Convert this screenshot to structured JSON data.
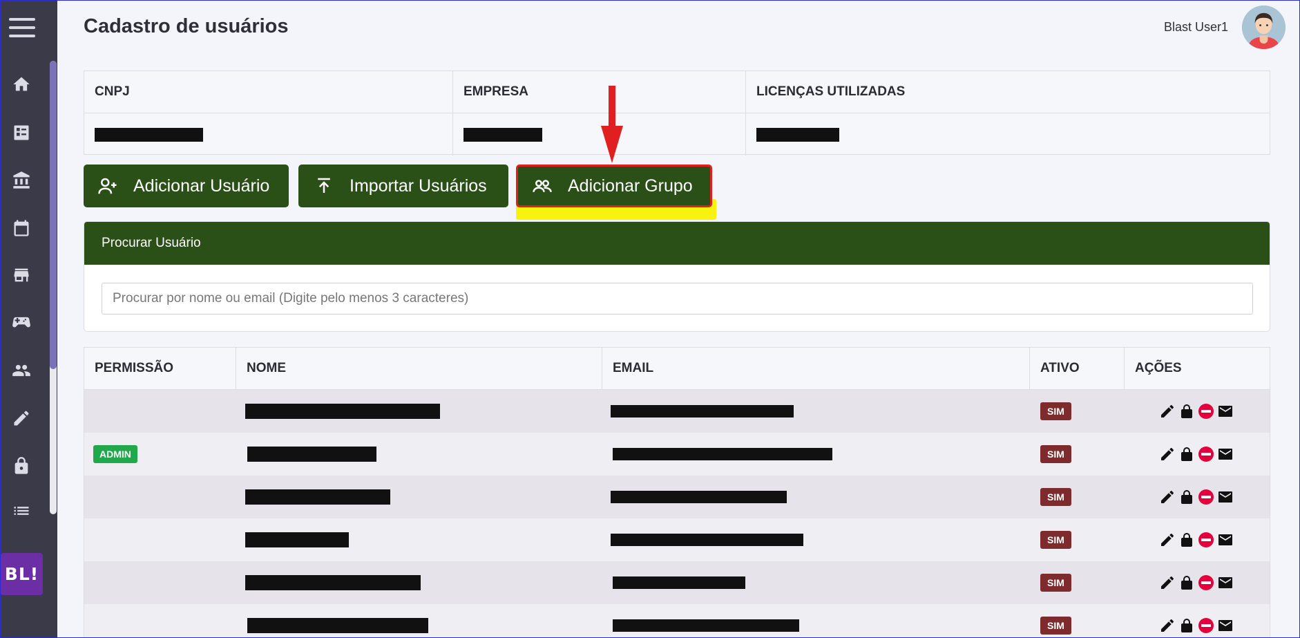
{
  "app": {
    "page_title": "Cadastro de usuários",
    "user_name": "Blast User1",
    "brand": "BL!"
  },
  "sidebar": {
    "items": [
      {
        "icon": "home-icon"
      },
      {
        "icon": "dashboard-icon"
      },
      {
        "icon": "bank-icon"
      },
      {
        "icon": "calendar-icon"
      },
      {
        "icon": "store-icon"
      },
      {
        "icon": "gamepad-icon"
      },
      {
        "icon": "people-icon"
      },
      {
        "icon": "edit-icon"
      },
      {
        "icon": "lock-icon"
      },
      {
        "icon": "list-icon"
      }
    ]
  },
  "company": {
    "headers": [
      "CNPJ",
      "EMPRESA",
      "LICENÇAS UTILIZADAS"
    ]
  },
  "buttons": {
    "add_user": "Adicionar Usuário",
    "import_users": "Importar Usuários",
    "add_group": "Adicionar Grupo"
  },
  "search": {
    "title": "Procurar Usuário",
    "placeholder": "Procurar por nome ou email (Digite pelo menos 3 caracteres)"
  },
  "users_table": {
    "headers": [
      "PERMISSÃO",
      "NOME",
      "EMAIL",
      "ATIVO",
      "AÇÕES"
    ],
    "rows": [
      {
        "permission": "",
        "active": "SIM"
      },
      {
        "permission": "ADMIN",
        "active": "SIM"
      },
      {
        "permission": "",
        "active": "SIM"
      },
      {
        "permission": "",
        "active": "SIM"
      },
      {
        "permission": "",
        "active": "SIM"
      },
      {
        "permission": "",
        "active": "SIM"
      }
    ]
  },
  "colors": {
    "primary_green": "#2a5018",
    "sidebar": "#3a3a48",
    "admin_badge": "#21a84a",
    "active_badge": "#7e2b2e",
    "highlight": "#f7f30e",
    "annotation_red": "#e02020"
  }
}
